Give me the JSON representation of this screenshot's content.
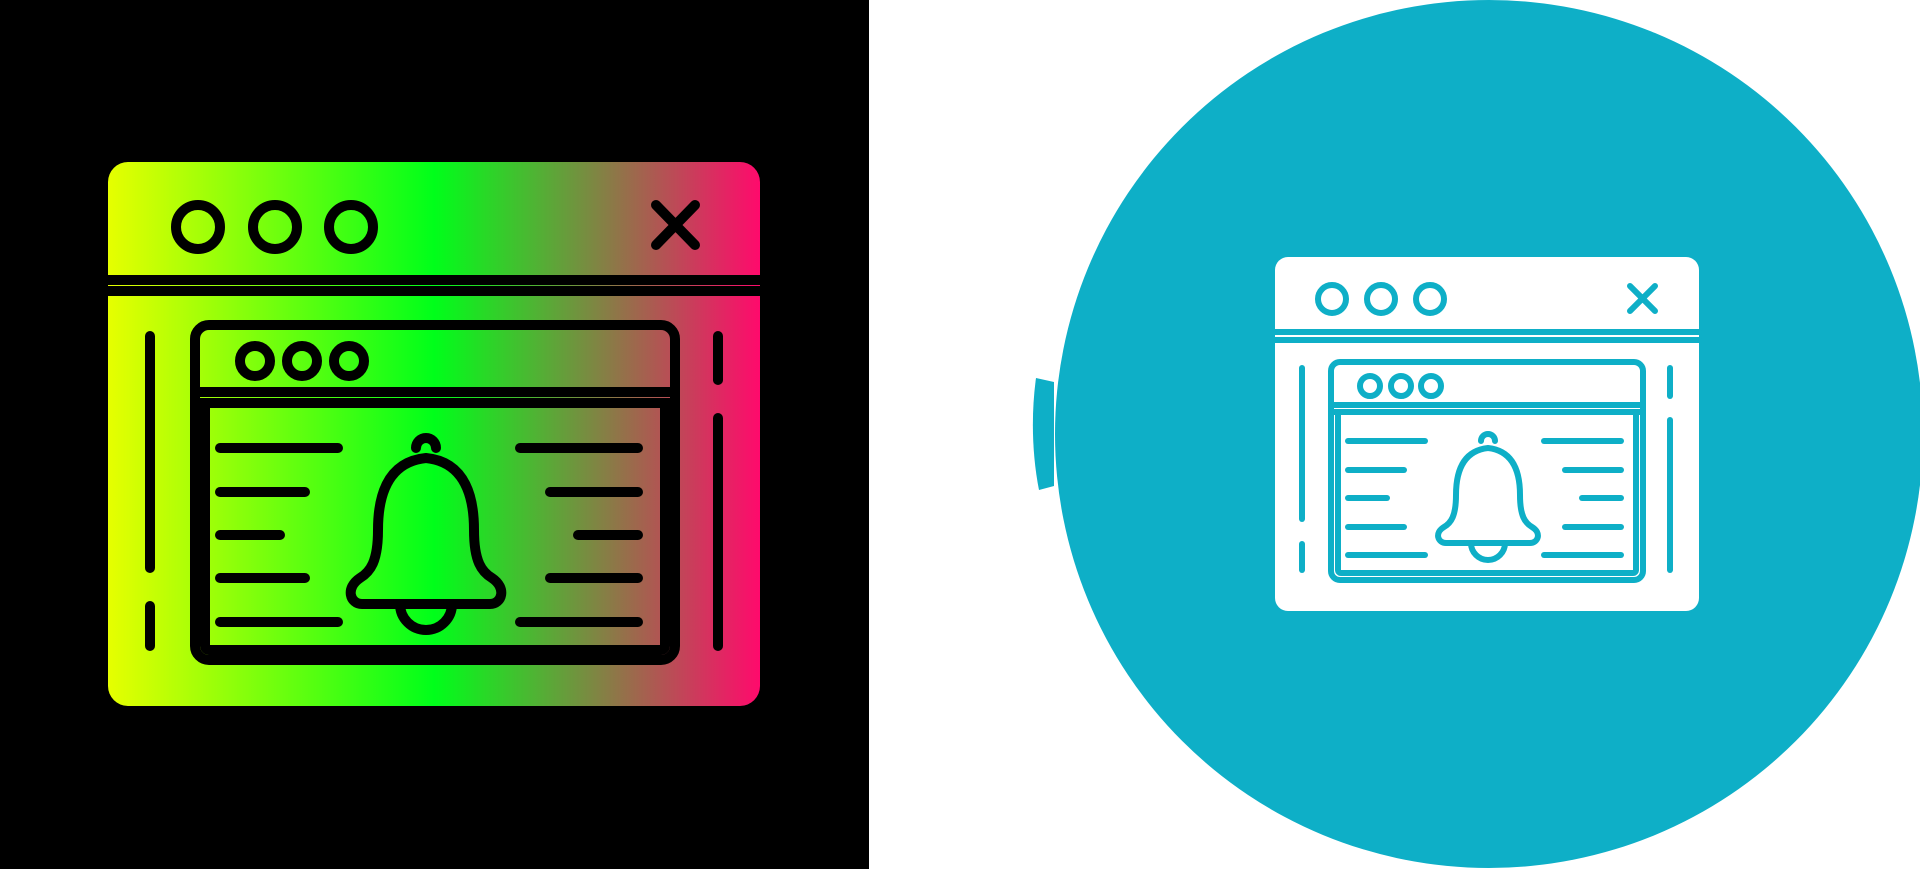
{
  "icons": [
    {
      "name": "browser-notification-icon",
      "variant": "gradient-on-black",
      "background": "#000000",
      "gradient_colors": [
        "#e6ff00",
        "#00ff1a",
        "#ff0a6c"
      ],
      "stroke_color": "#000000"
    },
    {
      "name": "browser-notification-icon",
      "variant": "white-on-teal-circle",
      "background": "#ffffff",
      "circle_color": "#0eafc7",
      "fill_color": "#ffffff",
      "stroke_color": "#0eafc7"
    }
  ]
}
